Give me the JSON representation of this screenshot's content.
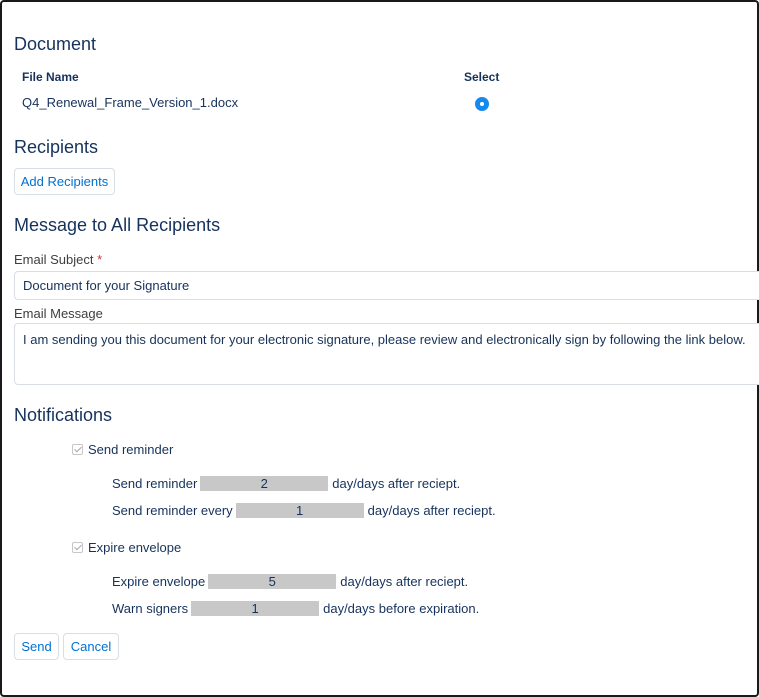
{
  "document": {
    "heading": "Document",
    "col_file_name": "File Name",
    "col_select": "Select",
    "file_name": "Q4_Renewal_Frame_Version_1.docx"
  },
  "recipients": {
    "heading": "Recipients",
    "add_button": "Add Recipients"
  },
  "message": {
    "heading": "Message to All Recipients",
    "subject_label": "Email Subject",
    "required_mark": "*",
    "subject_value": "Document for your Signature",
    "message_label": "Email Message",
    "message_value": "I am sending you this document for your electronic signature, please review and electronically sign by following the link below."
  },
  "notifications": {
    "heading": "Notifications",
    "send_reminder": {
      "checkbox_label": "Send reminder",
      "checked": true,
      "after_label": "Send reminder",
      "after_value": "2",
      "after_suffix": "day/days after reciept.",
      "every_label": "Send reminder every",
      "every_value": "1",
      "every_suffix": "day/days after reciept."
    },
    "expire_envelope": {
      "checkbox_label": "Expire envelope",
      "checked": true,
      "expire_label": "Expire envelope",
      "expire_value": "5",
      "expire_suffix": "day/days after reciept.",
      "warn_label": "Warn signers",
      "warn_value": "1",
      "warn_suffix": "day/days before expiration."
    }
  },
  "actions": {
    "send": "Send",
    "cancel": "Cancel"
  },
  "colors": {
    "heading": "#16325c",
    "link_blue": "#0070d2",
    "radio_blue": "#1589ee",
    "field_gray": "#c8c8c8",
    "required_red": "#c23934"
  }
}
